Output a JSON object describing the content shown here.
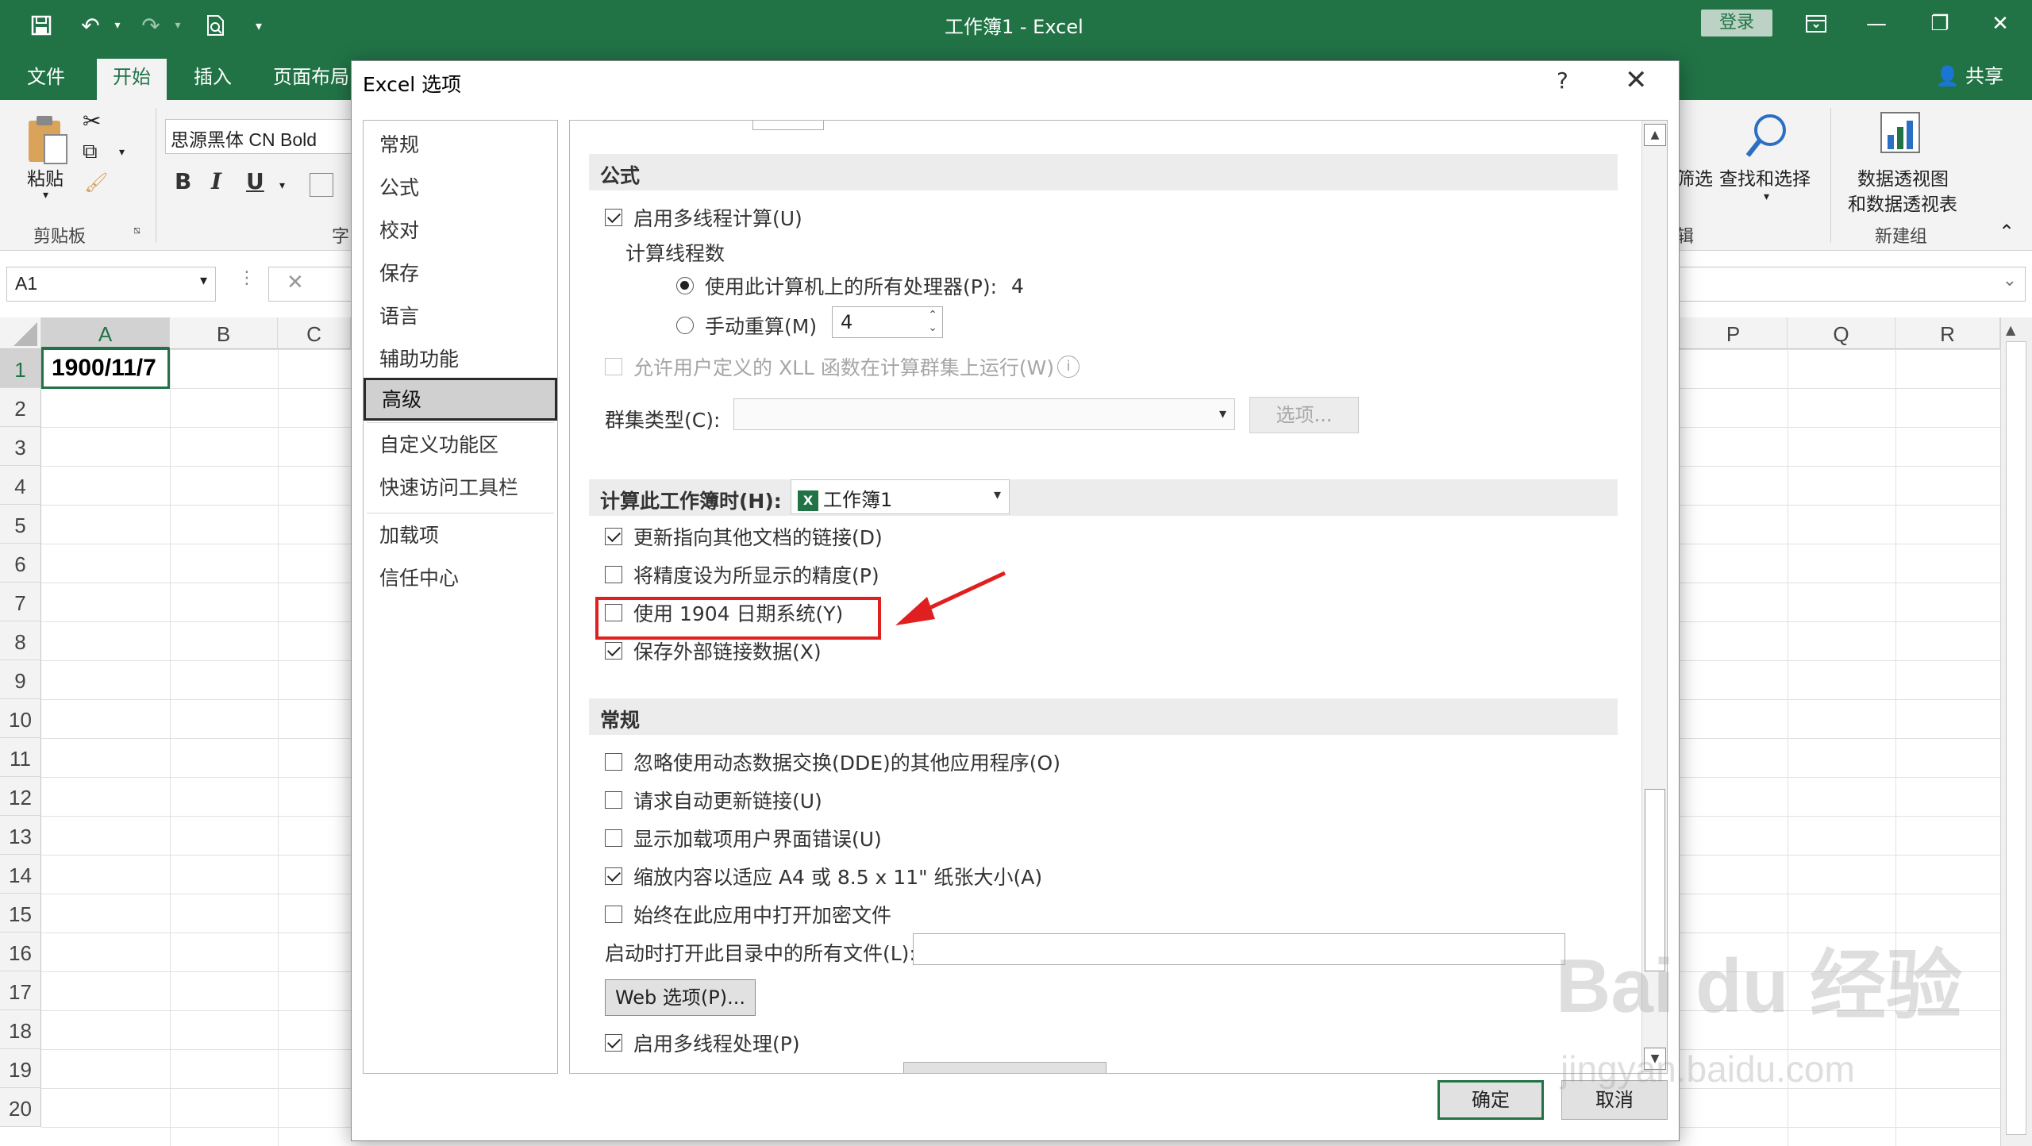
{
  "window": {
    "title": "工作簿1 - Excel",
    "login_label": "登录",
    "share_label": "共享"
  },
  "ribbon_tabs": [
    "文件",
    "开始",
    "插入",
    "页面布局"
  ],
  "ribbon": {
    "paste_label": "粘贴",
    "clipboard_label": "剪贴板",
    "font_group_fragment": "字",
    "font_name": "思源黑体 CN Bold",
    "bold": "B",
    "italic": "I",
    "underline": "U",
    "filter_fragment": "筛选",
    "find_select_label": "查找和选择",
    "edit_fragment": "辑",
    "pivot_label_line1": "数据透视图",
    "pivot_label_line2": "和数据透视表",
    "new_group_label": "新建组"
  },
  "formula_bar": {
    "name_box": "A1"
  },
  "grid": {
    "left_columns": [
      "A",
      "B",
      "C"
    ],
    "right_columns": [
      "P",
      "Q",
      "R"
    ],
    "rows": [
      "1",
      "2",
      "3",
      "4",
      "5",
      "6",
      "7",
      "8",
      "9",
      "10",
      "11",
      "12",
      "13",
      "14",
      "15",
      "16",
      "17",
      "18",
      "19",
      "20"
    ],
    "a1_value": "1900/11/7"
  },
  "dialog": {
    "title": "Excel 选项",
    "help": "?",
    "nav": [
      "常规",
      "公式",
      "校对",
      "保存",
      "语言",
      "辅助功能",
      "高级",
      "自定义功能区",
      "快速访问工具栏",
      "加载项",
      "信任中心"
    ],
    "active_nav": "高级",
    "sections": {
      "formula": {
        "header": "公式",
        "multithread": "启用多线程计算(U)",
        "thread_count_label": "计算线程数",
        "all_processors": "使用此计算机上的所有处理器(P):",
        "processor_count": "4",
        "manual": "手动重算(M)",
        "manual_value": "4",
        "xll": "允许用户定义的 XLL 函数在计算群集上运行(W)",
        "cluster_type": "群集类型(C):",
        "options_button": "选项..."
      },
      "workbook": {
        "header": "计算此工作簿时(H):",
        "workbook_name": "工作簿1",
        "update_links": "更新指向其他文档的链接(D)",
        "precision": "将精度设为所显示的精度(P)",
        "date_1904": "使用 1904 日期系统(Y)",
        "save_external": "保存外部链接数据(X)"
      },
      "general": {
        "header": "常规",
        "ignore_dde": "忽略使用动态数据交换(DDE)的其他应用程序(O)",
        "auto_update": "请求自动更新链接(U)",
        "addin_errors": "显示加载项用户界面错误(U)",
        "scale_content": "缩放内容以适应 A4 或 8.5 x 11\" 纸张大小(A)",
        "open_encrypted": "始终在此应用中打开加密文件",
        "startup_open": "启动时打开此目录中的所有文件(L):",
        "web_options": "Web 选项(P)...",
        "multiprocess": "启用多线程处理(P)"
      }
    },
    "ok_label": "确定",
    "cancel_label": "取消"
  },
  "watermark": {
    "main": "Bai du 经验",
    "sub": "jingyan.baidu.com"
  },
  "colors": {
    "excel_green": "#217346",
    "highlight_red": "#e02020"
  }
}
